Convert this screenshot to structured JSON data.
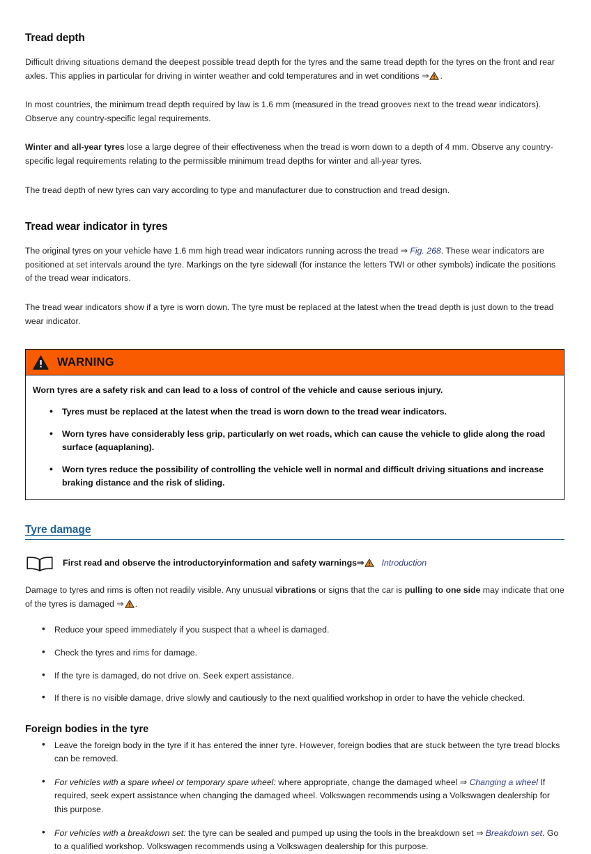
{
  "colors": {
    "warning_header_bg": "#f95c00",
    "link_blue": "#2f3c91",
    "heading_blue": "#1f6199",
    "triangle_orange": "#e8922f",
    "body_text": "#222222"
  },
  "sections": {
    "tread_depth": {
      "heading": "Tread depth",
      "para1_a": "Difficult driving situations demand the deepest possible tread depth for the tyres and the same tread depth for the tyres on the front and rear axles. This applies in particular for driving in winter weather and cold temperatures and in wet conditions ",
      "para1_arrow": "⇒",
      "para1_b": ".",
      "para2": "In most countries, the minimum tread depth required by law is 1.6 mm (measured in the tread grooves next to the tread wear indicators). Observe any country-specific legal requirements.",
      "para3_bold": "Winter and all-year tyres",
      "para3_rest": " lose a large degree of their effectiveness when the tread is worn down to a depth of 4 mm. Observe any country-specific legal requirements relating to the permissible minimum tread depths for winter and all-year tyres.",
      "para4": "The tread depth of new tyres can vary according to type and manufacturer due to construction and tread design."
    },
    "tread_wear_indicator": {
      "heading": "Tread wear indicator in tyres",
      "para1_a": "The original tyres on your vehicle have 1.6 mm high tread wear indicators running across the tread ",
      "para1_arrow": "⇒",
      "para1_link": "Fig. 268",
      "para1_b": ". These wear indicators are positioned at set intervals around the tyre. Markings on the tyre sidewall (for instance the letters TWI or other symbols) indicate the positions of the tread wear indicators.",
      "para2": "The tread wear indicators show if a tyre is worn down. The tyre must be replaced at the latest when the tread depth is just down to the tread wear indicator."
    }
  },
  "warning_box": {
    "icon": "warning-triangle-icon",
    "label": "WARNING",
    "lead": "Worn tyres are a safety risk and can lead to a loss of control of the vehicle and cause serious injury.",
    "items": [
      "Tyres must be replaced at the latest when the tread is worn down to the tread wear indicators.",
      "Worn tyres have considerably less grip, particularly on wet roads, which can cause the vehicle to glide along the road surface (aquaplaning).",
      "Worn tyres reduce the possibility of controlling the vehicle well in normal and difficult driving situations and increase braking distance and the risk of sliding."
    ]
  },
  "tyre_damage": {
    "heading": "Tyre damage",
    "readfirst": {
      "icon": "book-icon",
      "text": "First read and observe the introductoryinformation and safety warnings",
      "arrow": "⇒",
      "link": "Introduction"
    },
    "intro_a": "Damage to tyres and rims is often not readily visible. Any unusual ",
    "intro_bold1": "vibrations",
    "intro_b": " or signs that the car is ",
    "intro_bold2": "pulling to one side",
    "intro_c": " may indicate that one of the tyres is damaged ",
    "intro_arrow": "⇒",
    "intro_d": ".",
    "items": [
      "Reduce your speed immediately if you suspect that a wheel is damaged.",
      "Check the tyres and rims for damage.",
      "If the tyre is damaged, do not drive on. Seek expert assistance.",
      "If there is no visible damage, drive slowly and cautiously to the next qualified workshop in order to have the vehicle checked."
    ]
  },
  "foreign_bodies": {
    "heading": "Foreign bodies in the tyre",
    "item1": "Leave the foreign body in the tyre if it has entered the inner tyre. However, foreign bodies that are stuck between the tyre tread blocks can be removed.",
    "item2_italic": "For vehicles with a spare wheel or temporary spare wheel:",
    "item2_a": " where appropriate, change the damaged wheel ",
    "item2_arrow": "⇒",
    "item2_link": "Changing a wheel",
    "item2_b": " If required, seek expert assistance when changing the damaged wheel. Volkswagen recommends using a Volkswagen dealership for this purpose.",
    "item3_italic": "For vehicles with a breakdown set:",
    "item3_a": " the tyre can be sealed and pumped up using the tools in the breakdown set ",
    "item3_arrow": "⇒",
    "item3_link": "Breakdown set",
    "item3_b": ". Go to a qualified workshop. Volkswagen recommends using a Volkswagen dealership for this purpose."
  }
}
